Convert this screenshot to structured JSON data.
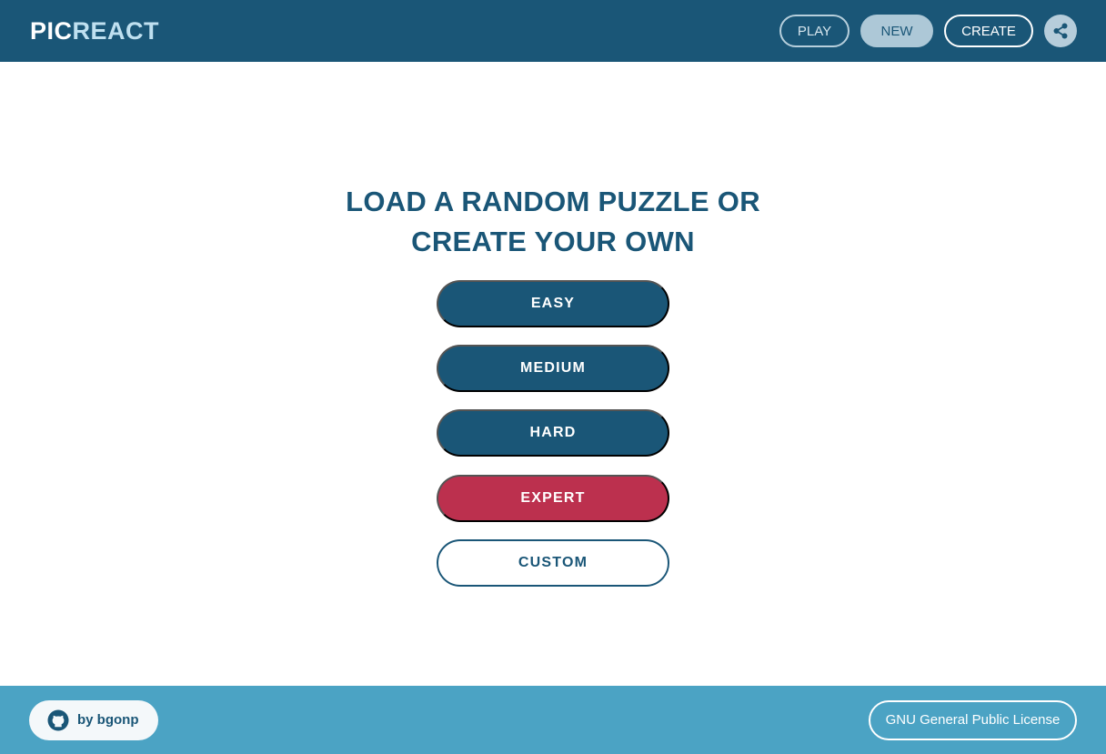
{
  "header": {
    "logo_part1": "PIC",
    "logo_part2": "REACT",
    "nav": {
      "play": "PLAY",
      "new": "NEW",
      "create": "CREATE",
      "share_icon": "share-icon"
    }
  },
  "main": {
    "title_line1": "LOAD A RANDOM PUZZLE OR",
    "title_line2": "CREATE YOUR OWN",
    "buttons": {
      "easy": "EASY",
      "medium": "MEDIUM",
      "hard": "HARD",
      "expert": "EXPERT",
      "custom": "CUSTOM"
    }
  },
  "footer": {
    "author_icon": "github-icon",
    "author": "by bgonp",
    "license": "GNU General Public License"
  },
  "colors": {
    "primary": "#1a5677",
    "expert": "#bc304e",
    "footer": "#4ba3c4",
    "active_nav": "#adc8d7"
  }
}
